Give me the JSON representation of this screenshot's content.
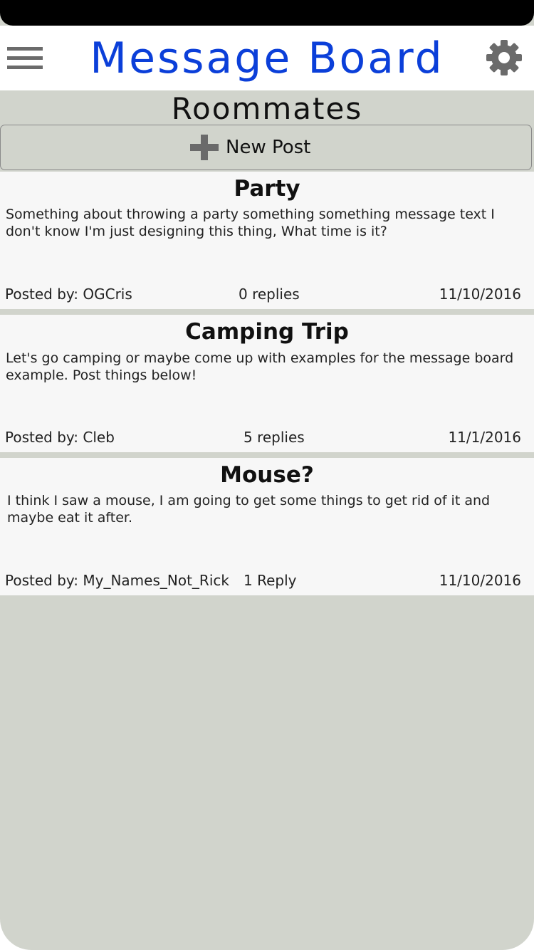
{
  "header": {
    "title": "Message Board",
    "menu_icon": "hamburger-menu-icon",
    "settings_icon": "gear-icon",
    "title_color": "#0b3fd9"
  },
  "board": {
    "name": "Roommates"
  },
  "new_post": {
    "label": "New Post",
    "icon": "plus-icon"
  },
  "posts": [
    {
      "title": "Party",
      "body": "Something about throwing a party something something message text I don't know I'm just designing this thing, What time is it?",
      "author": "Posted by: OGCris",
      "replies": "0 replies",
      "date": "11/10/2016"
    },
    {
      "title": "Camping Trip",
      "body": "Let's go camping or maybe come up with examples for the message board example. Post things below!",
      "author": "Posted by: Cleb",
      "replies": "5 replies",
      "date": "11/1/2016"
    },
    {
      "title": "Mouse?",
      "body": "I think I saw a mouse, I am going to get some things to get rid of it and maybe eat it after.",
      "author": "Posted by: My_Names_Not_Rick",
      "replies": "1 Reply",
      "date": "11/10/2016"
    }
  ]
}
